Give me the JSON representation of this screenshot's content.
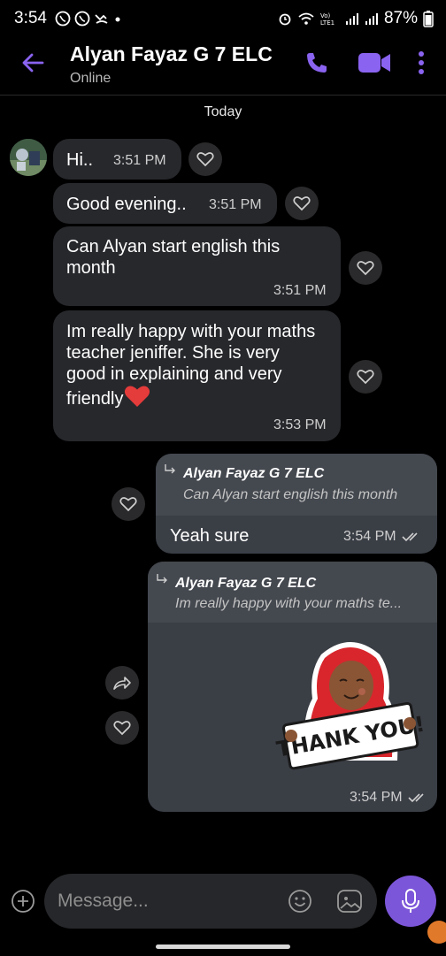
{
  "status_bar": {
    "time": "3:54",
    "battery": "87%",
    "network_label": "Vo) LTE1"
  },
  "header": {
    "title": "Alyan Fayaz G 7 ELC",
    "subtitle": "Online"
  },
  "date_separator": "Today",
  "messages": [
    {
      "text": "Hi..",
      "time": "3:51 PM"
    },
    {
      "text": "Good evening..",
      "time": "3:51 PM"
    },
    {
      "text_line1": "Can Alyan start english this",
      "text_line2": "month",
      "time": "3:51 PM"
    },
    {
      "text_line1": "Im really happy with your maths",
      "text_line2": "teacher jeniffer. She is very",
      "text_line3": "good in explaining and very",
      "text_line4": "friendly",
      "emoji": "❤️",
      "time": "3:53 PM"
    },
    {
      "reply_name": "Alyan Fayaz G 7 ELC",
      "reply_text": "Can Alyan start english this month",
      "text": "Yeah sure",
      "time": "3:54 PM"
    },
    {
      "reply_name": "Alyan Fayaz G 7 ELC",
      "reply_text": "Im really happy with your maths te...",
      "sticker_text": "THANK YOU!",
      "time": "3:54 PM"
    }
  ],
  "composer": {
    "placeholder": "Message..."
  },
  "colors": {
    "accent": "#8a63f0",
    "bubble_in": "#27282c",
    "bubble_out": "#3a3e45",
    "mic_button": "#7c56d9"
  },
  "icons": [
    "back-arrow-icon",
    "phone-icon",
    "video-icon",
    "more-vert-icon",
    "heart-icon",
    "share-icon",
    "plus-icon",
    "emoji-icon",
    "sticker-icon",
    "mic-icon",
    "double-check-icon"
  ]
}
